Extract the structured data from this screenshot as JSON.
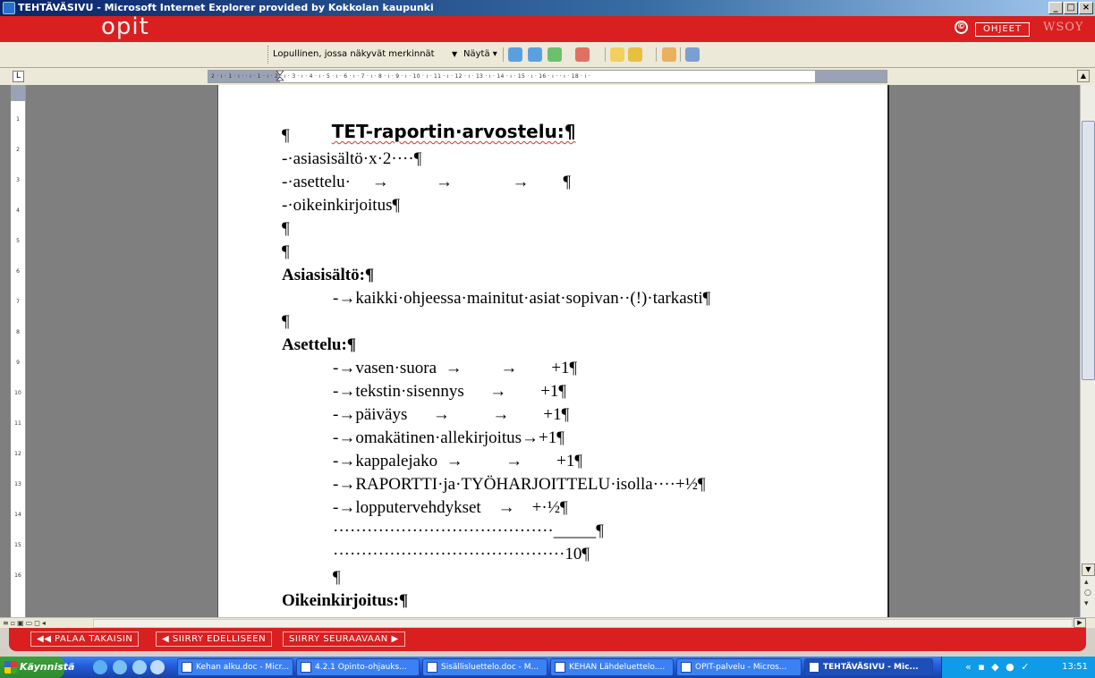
{
  "window": {
    "title": "TEHTÄVÄSIVU - Microsoft Internet Explorer provided by Kokkolan kaupunki",
    "controls": [
      "_",
      "□",
      "×"
    ]
  },
  "brand": {
    "logo": "opit",
    "copyright_symbol": "©",
    "help_label": "OHJEET",
    "publisher": "WSOY",
    "color": "#d91f1f"
  },
  "toolbar": {
    "review_mode": "Lopullinen, jossa näkyvät merkinnät",
    "show_label": "Näytä ▾"
  },
  "ruler": {
    "ticks": "2 · ı · 1 · ı ·   · ı · 1 · ı · 2 · ı · 3 · ı · 4 · ı · 5 · ı · 6 · ı · 7 · ı · 8 · ı · 9 · ı · 10 · ı · 11 · ı · 12 · ı · 13 · ı · 14 · ı · 15 · ı · 16 · ı ·   · ı · 18 · ı ·"
  },
  "vruler": {
    "ticks": [
      "1",
      "2",
      "3",
      "4",
      "5",
      "6",
      "7",
      "8",
      "9",
      "10",
      "11",
      "12",
      "13",
      "14",
      "15",
      "16"
    ]
  },
  "document": {
    "title": "TET-raportin·arvostelu:¶",
    "lines": [
      {
        "text": "¶"
      },
      {
        "text": "-·asiasisältö·x·2····¶"
      },
      {
        "text": "-·asettelu·     →           →              →        ¶"
      },
      {
        "text": "-·oikeinkirjoitus¶"
      },
      {
        "text": "¶"
      },
      {
        "text": "¶"
      },
      {
        "text": "Asiasisältö:¶"
      },
      {
        "text": "            -→kaikki·ohjeessa·mainitut·asiat·sopivan··(!)·tarkasti¶"
      },
      {
        "text": "¶"
      },
      {
        "text": "Asettelu:¶"
      },
      {
        "text": "            -→vasen·suora  →         →        +1¶"
      },
      {
        "text": "            -→tekstin·sisennys      →        +1¶"
      },
      {
        "text": "            -→päiväys      →          →        +1¶"
      },
      {
        "text": "            -→omakätinen·allekirjoitus→+1¶"
      },
      {
        "text": "            -→kappalejako  →          →        +1¶"
      },
      {
        "text": "            -→RAPORTTI·ja·TYÖHARJOITTELU·isolla····+½¶"
      },
      {
        "text": "            -→lopputervehdykset    →    +·½¶"
      },
      {
        "text": "            ·······································_____¶"
      },
      {
        "text": "            ·········································10¶"
      },
      {
        "text": "            ¶"
      },
      {
        "text": "Oikeinkirjoitus:¶"
      }
    ]
  },
  "nav": {
    "back": "◀◀  PALAA TAKAISIN",
    "previous": "◀  SIIRRY EDELLISEEN",
    "next": "SIIRRY SEURAAVAAN  ▶"
  },
  "taskbar": {
    "start": "Käynnistä",
    "tasks": [
      "Kehan alku.doc - Micr...",
      "4.2.1 Opinto-ohjauks...",
      "Sisällisluettelo.doc - M...",
      "KEHAN Lähdeluettelo....",
      "OPIT-palvelu - Micros...",
      "TEHTÄVÄSIVU - Mic..."
    ],
    "clock": "13:51"
  }
}
